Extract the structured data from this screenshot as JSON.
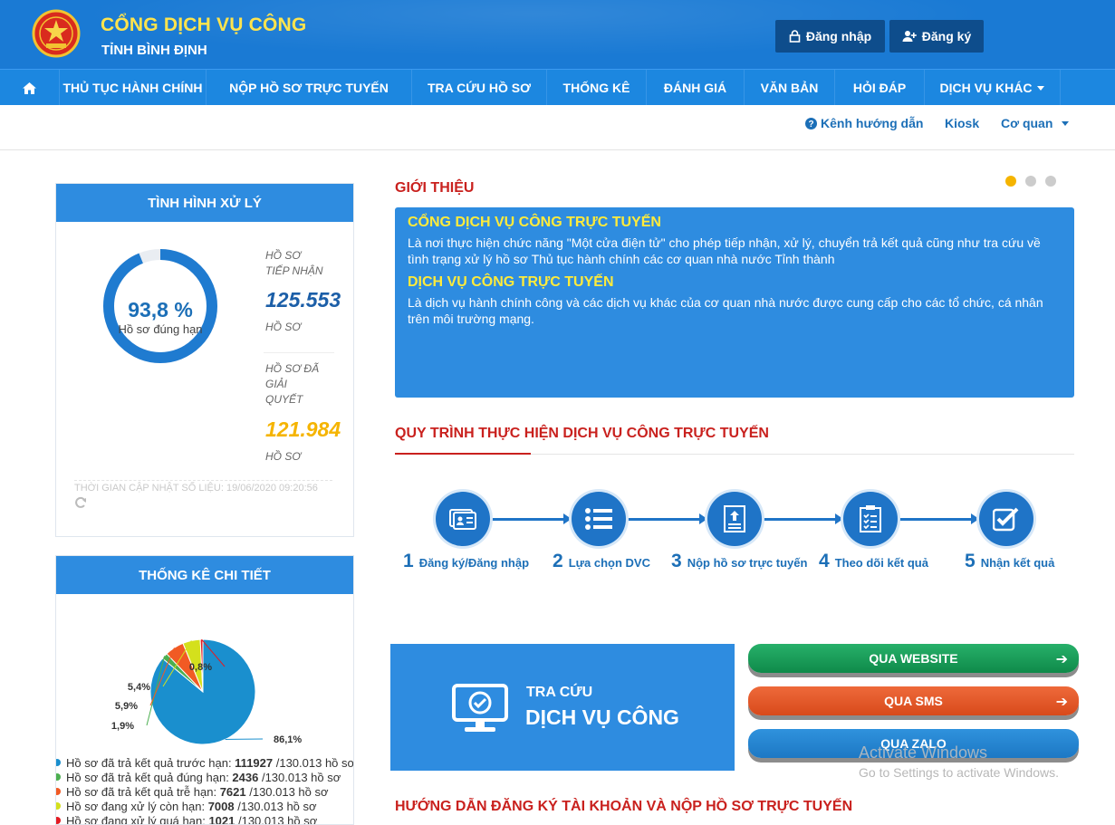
{
  "header": {
    "title": "CỔNG DỊCH VỤ CÔNG",
    "subtitle": "TỈNH BÌNH ĐỊNH",
    "login_label": "Đăng nhập",
    "register_label": "Đăng ký"
  },
  "nav": {
    "items": [
      {
        "label": "THỦ TỤC HÀNH CHÍNH"
      },
      {
        "label": "NỘP HỒ SƠ TRỰC TUYẾN"
      },
      {
        "label": "TRA CỨU HỒ SƠ"
      },
      {
        "label": "THỐNG KÊ"
      },
      {
        "label": "ĐÁNH GIÁ"
      },
      {
        "label": "VĂN BẢN"
      },
      {
        "label": "HỎI ĐÁP"
      },
      {
        "label": "DỊCH VỤ KHÁC"
      }
    ]
  },
  "subnav": {
    "guide": "Kênh hướng dẫn",
    "kiosk": "Kiosk",
    "agency": "Cơ quan"
  },
  "status": {
    "heading": "TÌNH HÌNH XỬ LÝ",
    "percent_text": "93,8 %",
    "percent_value": 93.8,
    "percent_label": "Hồ sơ đúng hạn",
    "received_label_1": "HỒ SƠ",
    "received_label_2": "TIẾP NHẬN",
    "received_value": "125.553",
    "received_unit": "HỒ SƠ",
    "resolved_label_1": "HỒ SƠ ĐÃ",
    "resolved_label_2": "GIẢI",
    "resolved_label_3": "QUYẾT",
    "resolved_value": "121.984",
    "resolved_unit": "HỒ SƠ",
    "updated": "THỜI GIAN CẬP NHẬT SỐ LIỆU: 19/06/2020 09:20:56"
  },
  "stats": {
    "heading": "THỐNG KÊ CHI TIẾT",
    "legend": [
      {
        "text": "Hồ sơ đã trả kết quả trước hạn: ",
        "value": "111927",
        "suffix": " /130.013 hồ sơ",
        "color": "#1a8fce"
      },
      {
        "text": "Hồ sơ đã trả kết quả đúng hạn: ",
        "value": "2436",
        "suffix": " /130.013 hồ sơ",
        "color": "#4caf50"
      },
      {
        "text": "Hồ sơ đã trả kết quả trễ hạn: ",
        "value": "7621",
        "suffix": " /130.013 hồ sơ",
        "color": "#f15a24"
      },
      {
        "text": "Hồ sơ đang xử lý còn hạn: ",
        "value": "7008",
        "suffix": " /130.013 hồ sơ",
        "color": "#d4e01c"
      },
      {
        "text": "Hồ sơ đang xử lý quá hạn: ",
        "value": "1021",
        "suffix": " /130.013 hồ sơ",
        "color": "#e31b23"
      }
    ]
  },
  "chart_data": {
    "type": "pie",
    "slices": [
      {
        "value": 86.1,
        "label": "86,1%",
        "color": "#1a8fce"
      },
      {
        "value": 1.9,
        "label": "1,9%",
        "color": "#4caf50"
      },
      {
        "value": 5.9,
        "label": "5,9%",
        "color": "#f15a24"
      },
      {
        "value": 5.4,
        "label": "5,4%",
        "color": "#d4e01c"
      },
      {
        "value": 0.8,
        "label": "0,8%",
        "color": "#e31b23"
      }
    ]
  },
  "intro": {
    "section_title": "GIỚI THIỆU",
    "h1": "CỔNG DỊCH VỤ CÔNG TRỰC TUYẾN",
    "p1": "Là nơi thực hiện chức năng \"Một cửa điện tử\" cho phép tiếp nhận, xử lý, chuyển trả kết quả cũng như tra cứu về tình trạng xử lý hồ sơ Thủ tục hành chính các cơ quan nhà nước Tỉnh thành",
    "h2": "DỊCH VỤ CÔNG TRỰC TUYẾN",
    "p2": "Là dịch vụ hành chính công và các dịch vụ khác của cơ quan nhà nước được cung cấp cho các tổ chức, cá nhân trên môi trường mạng."
  },
  "process": {
    "title": "QUY TRÌNH THỰC HIỆN DỊCH VỤ CÔNG TRỰC TUYẾN",
    "steps": [
      {
        "num": "1",
        "label": "Đăng ký/Đăng nhập"
      },
      {
        "num": "2",
        "label": "Lựa chọn DVC"
      },
      {
        "num": "3",
        "label": "Nộp hồ sơ trực tuyến"
      },
      {
        "num": "4",
        "label": "Theo dõi kết quả"
      },
      {
        "num": "5",
        "label": "Nhận kết quả"
      }
    ]
  },
  "lookup": {
    "small": "TRA CỨU",
    "big": "DỊCH VỤ CÔNG"
  },
  "channels": {
    "web": "QUA WEBSITE",
    "sms": "QUA SMS",
    "zalo": "QUA ZALO"
  },
  "guide_title": "HƯỚNG DẪN ĐĂNG KÝ TÀI KHOẢN VÀ NỘP HỒ SƠ TRỰC TUYẾN",
  "watermark": {
    "line1": "Activate Windows",
    "line2": "Go to Settings to activate Windows."
  }
}
